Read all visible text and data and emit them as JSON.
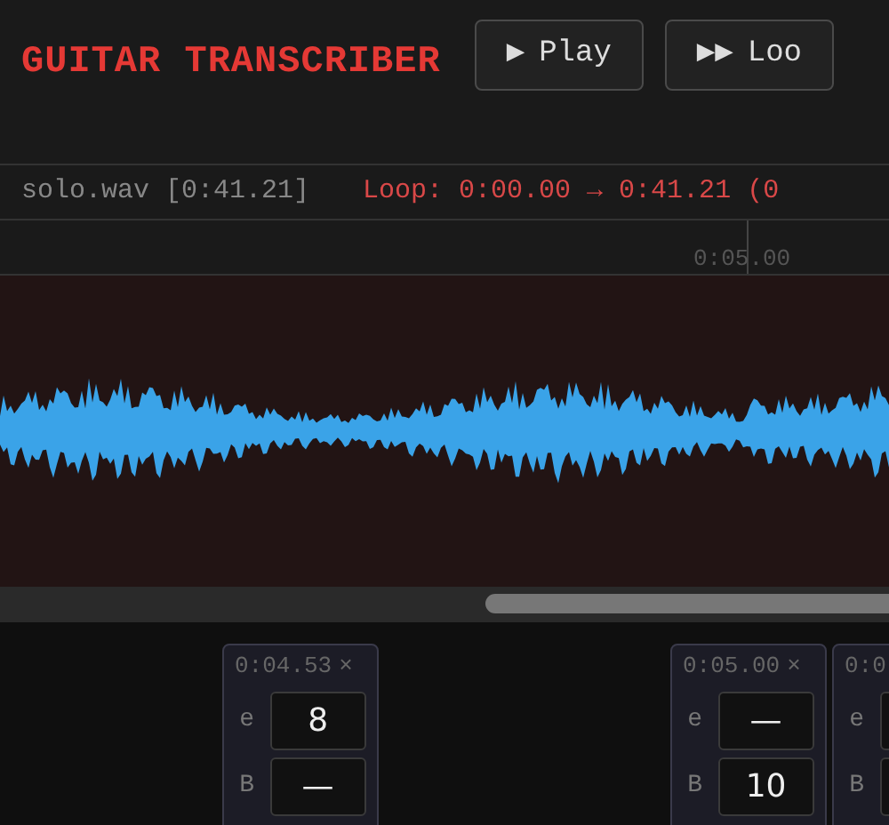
{
  "header": {
    "title": "GUITAR TRANSCRIBER",
    "buttons": [
      {
        "icon": "▶",
        "label": "Play"
      },
      {
        "icon": "▶▶",
        "label": "Loo"
      }
    ]
  },
  "status": {
    "file": "solo.wav [0:41.21]",
    "loop": "Loop: 0:00.00 → 0:41.21 (0"
  },
  "ruler": {
    "ticks": [
      {
        "label": "0:05.00"
      }
    ]
  },
  "notes": [
    {
      "time": "0:04.53",
      "close": "×",
      "strings": [
        {
          "name": "e",
          "value": "8"
        },
        {
          "name": "B",
          "value": "—"
        }
      ]
    },
    {
      "time": "0:05.00",
      "close": "×",
      "strings": [
        {
          "name": "e",
          "value": "—"
        },
        {
          "name": "B",
          "value": "10"
        }
      ]
    },
    {
      "time": "0:0",
      "strings": [
        {
          "name": "e"
        },
        {
          "name": "B"
        }
      ]
    }
  ]
}
